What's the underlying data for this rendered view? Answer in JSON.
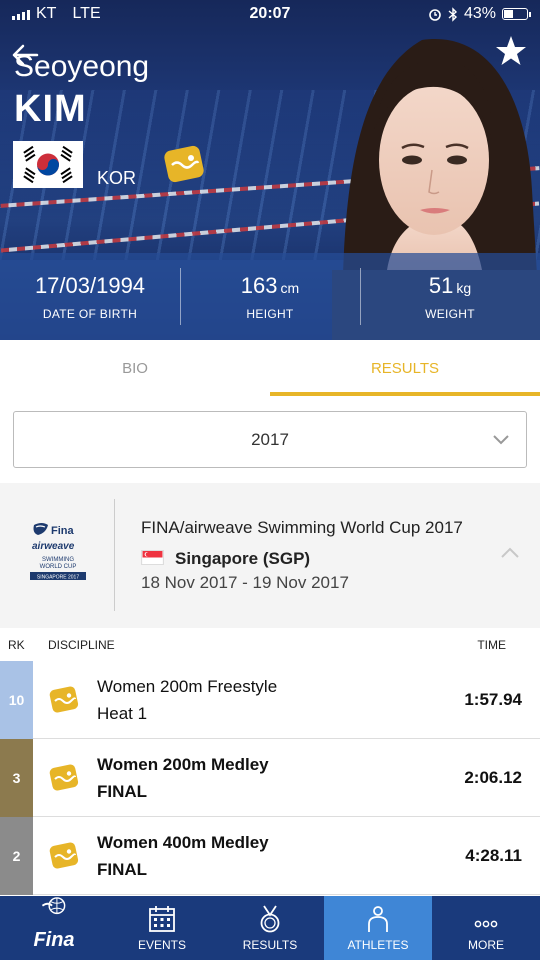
{
  "status_bar": {
    "carrier": "KT",
    "network": "LTE",
    "time": "20:07",
    "battery": "43%",
    "battery_fraction": 0.43
  },
  "athlete": {
    "first_name": "Seoyeong",
    "last_name": "KIM",
    "country": "KOR",
    "date_of_birth": "17/03/1994",
    "date_of_birth_label": "DATE OF BIRTH",
    "height": "163",
    "height_unit": "cm",
    "height_label": "HEIGHT",
    "weight": "51",
    "weight_unit": "kg",
    "weight_label": "WEIGHT"
  },
  "tabs": [
    {
      "label": "BIO",
      "active": false
    },
    {
      "label": "RESULTS",
      "active": true
    }
  ],
  "year_select": {
    "selected": "2017"
  },
  "event": {
    "logo_name": "Fina",
    "logo_sub": "airweave",
    "logo_line1": "SWIMMING",
    "logo_line2": "WORLD CUP",
    "logo_line3": "SINGAPORE 2017",
    "title": "FINA/airweave Swimming World Cup 2017",
    "location": "Singapore (SGP)",
    "dates": "18 Nov 2017 - 19 Nov 2017"
  },
  "table": {
    "headers": {
      "rank": "RK",
      "discipline": "DISCIPLINE",
      "time": "TIME"
    },
    "rows": [
      {
        "rank": "10",
        "rank_color": "#a9c2e6",
        "discipline": "Women 200m Freestyle",
        "phase": "Heat 1",
        "time": "1:57.94",
        "bold": false
      },
      {
        "rank": "3",
        "rank_color": "#8c7a4e",
        "discipline": "Women 200m Medley",
        "phase": "FINAL",
        "time": "2:06.12",
        "bold": true
      },
      {
        "rank": "2",
        "rank_color": "#8b8b8b",
        "discipline": "Women 400m Medley",
        "phase": "FINAL",
        "time": "4:28.11",
        "bold": true
      }
    ]
  },
  "bottom_nav": {
    "logo": "Fina",
    "items": [
      {
        "label": "EVENTS",
        "icon": "calendar-icon"
      },
      {
        "label": "RESULTS",
        "icon": "medal-icon"
      },
      {
        "label": "ATHLETES",
        "icon": "athlete-icon",
        "active": true
      },
      {
        "label": "MORE",
        "icon": "more-icon"
      }
    ]
  },
  "colors": {
    "accent_gold": "#e7b528",
    "nav_blue": "#1a3a7c",
    "nav_active": "#3f86d6"
  }
}
